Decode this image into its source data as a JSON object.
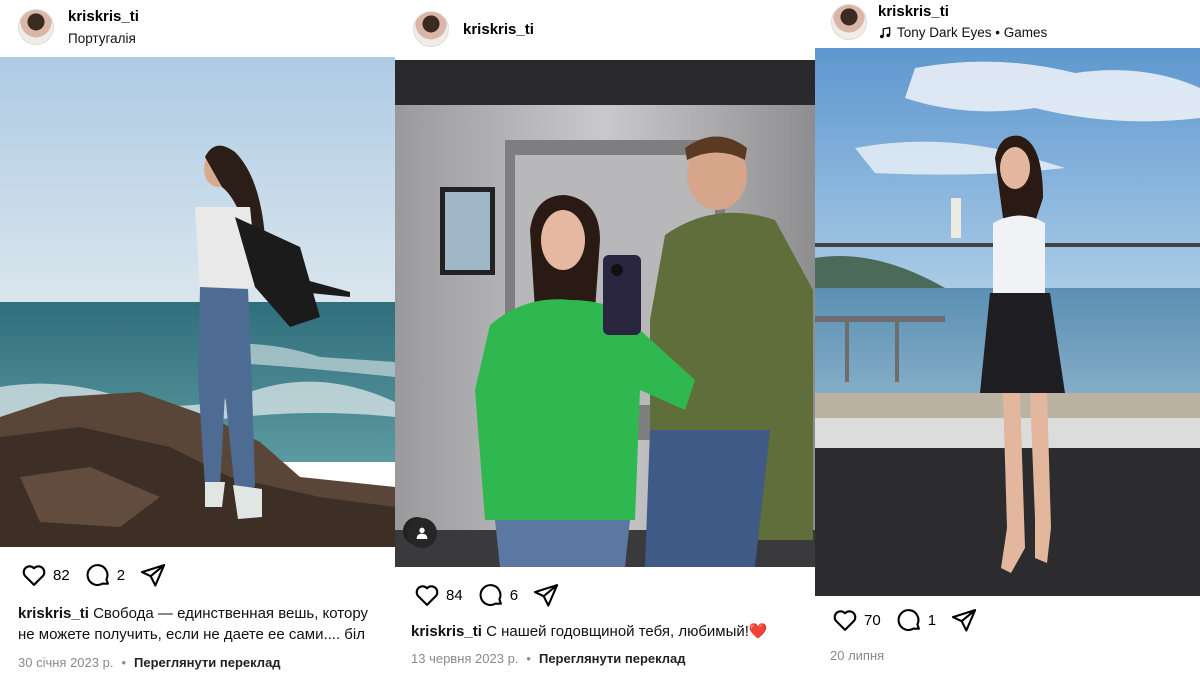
{
  "posts": [
    {
      "username": "kriskris_ti",
      "location": "Португалія",
      "likes": "82",
      "comments": "2",
      "caption_user": "kriskris_ti",
      "caption_line1": "Свобода — единственная вешь, котору",
      "caption_line2": "не можете получить, если не даете ее сами.... біл",
      "date": "30 січня 2023 р.",
      "translate": "Переглянути переклад"
    },
    {
      "username": "kriskris_ti",
      "likes": "84",
      "comments": "6",
      "caption_user": "kriskris_ti",
      "caption_text": "С нашей годовщиной тебя, любимый!❤️",
      "date": "13 червня 2023 р.",
      "translate": "Переглянути переклад"
    },
    {
      "username": "kriskris_ti",
      "music": "Tony Dark Eyes • Games",
      "likes": "70",
      "comments": "1",
      "date": "20 липня"
    }
  ],
  "icons": [
    "heart-icon",
    "comment-icon",
    "share-icon",
    "music-note-icon",
    "user-tag-icon"
  ],
  "colors": {
    "text": "#000000",
    "muted": "#8a8a8a",
    "background": "#ffffff"
  }
}
